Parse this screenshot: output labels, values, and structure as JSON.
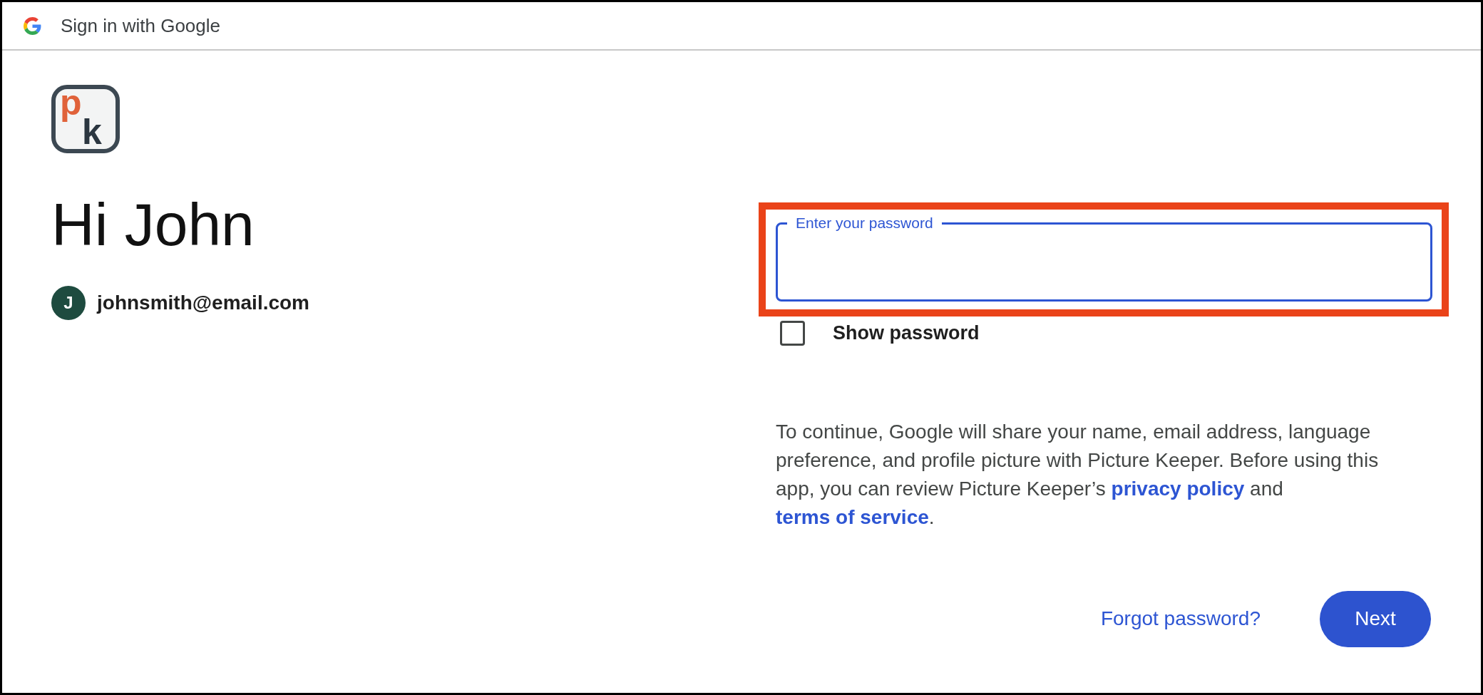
{
  "window": {
    "title": "Sign in with Google"
  },
  "logo": {
    "letters": [
      {
        "text": "p",
        "color": "#e0623a"
      },
      {
        "text": "k",
        "color": "#2b3640"
      }
    ]
  },
  "greeting": "Hi John",
  "account": {
    "initial": "J",
    "email": "johnsmith@email.com"
  },
  "password_field": {
    "label": "Enter your password",
    "focused": true,
    "highlighted": true
  },
  "show_password": {
    "label": "Show password",
    "checked": false
  },
  "consent": [
    {
      "kind": "text",
      "text": "To continue, Google will share your name, email address, language preference, and profile picture with Picture Keeper. Before using this app, you can review Picture Keeper’s "
    },
    {
      "kind": "link",
      "text": "privacy policy"
    },
    {
      "kind": "text",
      "text": " and "
    },
    {
      "kind": "link",
      "text": "terms of service"
    },
    {
      "kind": "text",
      "text": "."
    }
  ],
  "forgot_password": {
    "label": "Forgot password?"
  },
  "next_button": {
    "label": "Next"
  }
}
